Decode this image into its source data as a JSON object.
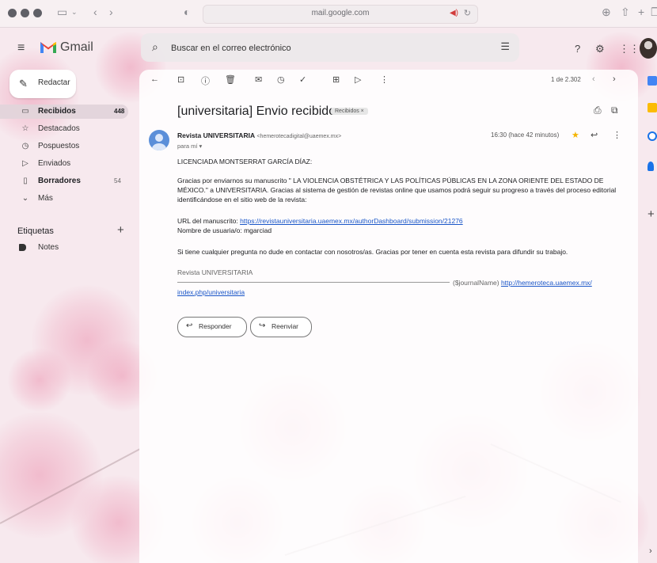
{
  "browser": {
    "url": "mail.google.com"
  },
  "gmail": {
    "app_name": "Gmail",
    "search_placeholder": "Buscar en el correo electrónico",
    "compose_label": "Redactar"
  },
  "nav": {
    "items": [
      {
        "label": "Recibidos",
        "count": "448",
        "icon": "inbox-icon"
      },
      {
        "label": "Destacados",
        "count": "",
        "icon": "star-icon"
      },
      {
        "label": "Pospuestos",
        "count": "",
        "icon": "clock-icon"
      },
      {
        "label": "Enviados",
        "count": "",
        "icon": "send-icon"
      },
      {
        "label": "Borradores",
        "count": "54",
        "icon": "draft-icon"
      },
      {
        "label": "Más",
        "count": "",
        "icon": "chevron-down-icon"
      }
    ],
    "labels_heading": "Etiquetas",
    "labels": [
      {
        "label": "Notes"
      }
    ]
  },
  "toolbar": {
    "pager": "1 de 2.302"
  },
  "email": {
    "subject": "[universitaria] Envio recibido",
    "chip": "Recibidos ×",
    "sender_name": "Revista UNIVERSITARIA",
    "sender_email": "<hemerotecadigital@uaemex.mx>",
    "to": "para mí ▾",
    "time": "16:30 (hace 42 minutos)",
    "greeting": "LICENCIADA MONTSERRAT GARCÍA DÍAZ:",
    "para1": "Gracias por enviarnos su manuscrito \" LA VIOLENCIA OBSTÉTRICA Y LAS POLÍTICAS PÚBLICAS EN LA ZONA ORIENTE DEL ESTADO DE MÉXICO.\" a UNIVERSITARIA. Gracias al sistema de gestión de revistas online que usamos podrá seguir su progreso a través del proceso editorial identificándose en el sitio web de la revista:",
    "url_label": "URL del manuscrito: ",
    "url": "https://revistauniversitaria.uaemex.mx/authorDashboard/submission/21276",
    "username_line": "Nombre de usuaria/o: mgarciad",
    "para2": "Si tiene cualquier pregunta no dude en contactar con nosotros/as. Gracias por tener en cuenta esta revista para difundir su trabajo.",
    "signature": "Revista UNIVERSITARIA",
    "journal_placeholder": "($journalName) ",
    "journal_url_1": "http://hemeroteca.uaemex.mx/",
    "journal_url_2": "index.php/universitaria",
    "reply_label": "Responder",
    "forward_label": "Reenviar"
  },
  "colors": {
    "accent_blue": "#1a56c8",
    "star": "#f4b400",
    "background": "#f7e9ee"
  }
}
